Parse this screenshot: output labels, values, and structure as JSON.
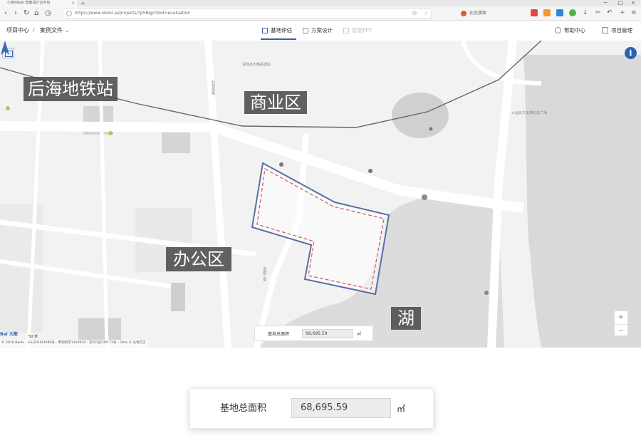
{
  "browser": {
    "tab_title": "小库XKool 智能设计云平台",
    "tab_close": "×",
    "new_tab": "+",
    "url": "https://www.xkool.ai/projects/?p56qp?tool=evaluation",
    "search_engine_label": "在此搜索",
    "window_controls": [
      "─",
      "□",
      "×"
    ]
  },
  "app": {
    "breadcrumb": {
      "project_center": "项目中心",
      "separator": "/",
      "case_file": "案例文件"
    },
    "tabs": [
      {
        "label": "基地评估",
        "state": "active"
      },
      {
        "label": "方案设计",
        "state": "normal"
      },
      {
        "label": "智能PPT",
        "state": "disabled"
      }
    ],
    "help_center": "帮助中心",
    "project_management": "项目管理"
  },
  "map": {
    "annotations": {
      "metro": "后海地铁站",
      "commercial": "商业区",
      "office": "办公区",
      "lake": "湖"
    },
    "poi_labels": {
      "hotel": "深圳高大精品酒店",
      "stadium": "大运会文化博纪念广场",
      "road_a": "科苑南路",
      "road_b": "海德三道"
    },
    "copyright": "© 2018 Baidu - GS(2016)2089号 - 甲测资字1100930 - 京ICP证030173号 - Data © 长地万方",
    "scale_label": "50 米",
    "zoom_in": "+",
    "zoom_out": "−",
    "info": "i",
    "site_area_label": "基地总面积",
    "site_area_value": "68,695.59",
    "site_area_unit": "㎡"
  },
  "zoom_panel": {
    "site_area_label": "基地总面积",
    "site_area_value": "68,695.59",
    "site_area_unit": "㎡"
  },
  "colors": {
    "accent": "#3a5f9a",
    "boundary_blue": "#5a6fa3",
    "boundary_red": "#d25a5a",
    "info_blue": "#2a64b0",
    "annotation_bg": "#464646"
  }
}
